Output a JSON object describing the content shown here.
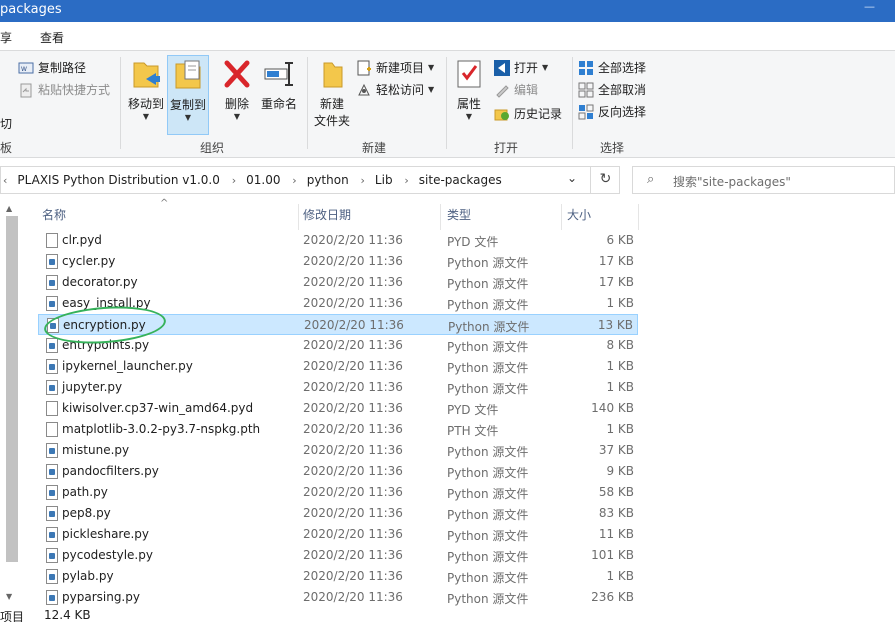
{
  "window": {
    "title": "packages"
  },
  "tabs": [
    {
      "label": "享"
    },
    {
      "label": "查看"
    }
  ],
  "ribbon": {
    "clipboard": {
      "copy_path": "复制路径",
      "paste_shortcut": "粘贴快捷方式",
      "cut": "切",
      "group_label": "板"
    },
    "organize": {
      "move_to": "移动到",
      "copy_to": "复制到",
      "delete": "删除",
      "rename": "重命名",
      "group_label": "组织"
    },
    "new": {
      "new_folder_line1": "新建",
      "new_folder_line2": "文件夹",
      "new_item": "新建项目",
      "easy_access": "轻松访问",
      "group_label": "新建"
    },
    "open": {
      "properties": "属性",
      "open": "打开",
      "edit": "编辑",
      "history": "历史记录",
      "group_label": "打开"
    },
    "select": {
      "select_all": "全部选择",
      "select_none": "全部取消",
      "invert": "反向选择",
      "group_label": "选择"
    }
  },
  "address": {
    "crumbs": [
      "PLAXIS Python Distribution v1.0.0",
      "01.00",
      "python",
      "Lib",
      "site-packages"
    ]
  },
  "search": {
    "placeholder": "搜索\"site-packages\""
  },
  "columns": {
    "name": "名称",
    "date": "修改日期",
    "type": "类型",
    "size": "大小"
  },
  "files": [
    {
      "name": "clr.pyd",
      "date": "2020/2/20 11:36",
      "type": "PYD 文件",
      "size": "6 KB",
      "icon": "pyd-file-icon"
    },
    {
      "name": "cycler.py",
      "date": "2020/2/20 11:36",
      "type": "Python 源文件",
      "size": "17 KB",
      "icon": "python-file-icon"
    },
    {
      "name": "decorator.py",
      "date": "2020/2/20 11:36",
      "type": "Python 源文件",
      "size": "17 KB",
      "icon": "python-file-icon"
    },
    {
      "name": "easy_install.py",
      "date": "2020/2/20 11:36",
      "type": "Python 源文件",
      "size": "1 KB",
      "icon": "python-file-icon"
    },
    {
      "name": "encryption.py",
      "date": "2020/2/20 11:36",
      "type": "Python 源文件",
      "size": "13 KB",
      "icon": "python-file-icon",
      "selected": true
    },
    {
      "name": "entrypoints.py",
      "date": "2020/2/20 11:36",
      "type": "Python 源文件",
      "size": "8 KB",
      "icon": "python-file-icon"
    },
    {
      "name": "ipykernel_launcher.py",
      "date": "2020/2/20 11:36",
      "type": "Python 源文件",
      "size": "1 KB",
      "icon": "python-file-icon"
    },
    {
      "name": "jupyter.py",
      "date": "2020/2/20 11:36",
      "type": "Python 源文件",
      "size": "1 KB",
      "icon": "python-file-icon"
    },
    {
      "name": "kiwisolver.cp37-win_amd64.pyd",
      "date": "2020/2/20 11:36",
      "type": "PYD 文件",
      "size": "140 KB",
      "icon": "pyd-file-icon"
    },
    {
      "name": "matplotlib-3.0.2-py3.7-nspkg.pth",
      "date": "2020/2/20 11:36",
      "type": "PTH 文件",
      "size": "1 KB",
      "icon": "pth-file-icon"
    },
    {
      "name": "mistune.py",
      "date": "2020/2/20 11:36",
      "type": "Python 源文件",
      "size": "37 KB",
      "icon": "python-file-icon"
    },
    {
      "name": "pandocfilters.py",
      "date": "2020/2/20 11:36",
      "type": "Python 源文件",
      "size": "9 KB",
      "icon": "python-file-icon"
    },
    {
      "name": "path.py",
      "date": "2020/2/20 11:36",
      "type": "Python 源文件",
      "size": "58 KB",
      "icon": "python-file-icon"
    },
    {
      "name": "pep8.py",
      "date": "2020/2/20 11:36",
      "type": "Python 源文件",
      "size": "83 KB",
      "icon": "python-file-icon"
    },
    {
      "name": "pickleshare.py",
      "date": "2020/2/20 11:36",
      "type": "Python 源文件",
      "size": "11 KB",
      "icon": "python-file-icon"
    },
    {
      "name": "pycodestyle.py",
      "date": "2020/2/20 11:36",
      "type": "Python 源文件",
      "size": "101 KB",
      "icon": "python-file-icon"
    },
    {
      "name": "pylab.py",
      "date": "2020/2/20 11:36",
      "type": "Python 源文件",
      "size": "1 KB",
      "icon": "python-file-icon"
    },
    {
      "name": "pyparsing.py",
      "date": "2020/2/20 11:36",
      "type": "Python 源文件",
      "size": "236 KB",
      "icon": "python-file-icon"
    }
  ],
  "status": {
    "items": "项目",
    "selected_size": "12.4 KB"
  },
  "colors": {
    "selection": "#cce8ff",
    "selection_border": "#99d1ff",
    "annotation": "#36b25a",
    "titlebar": "#2b6cc4"
  }
}
